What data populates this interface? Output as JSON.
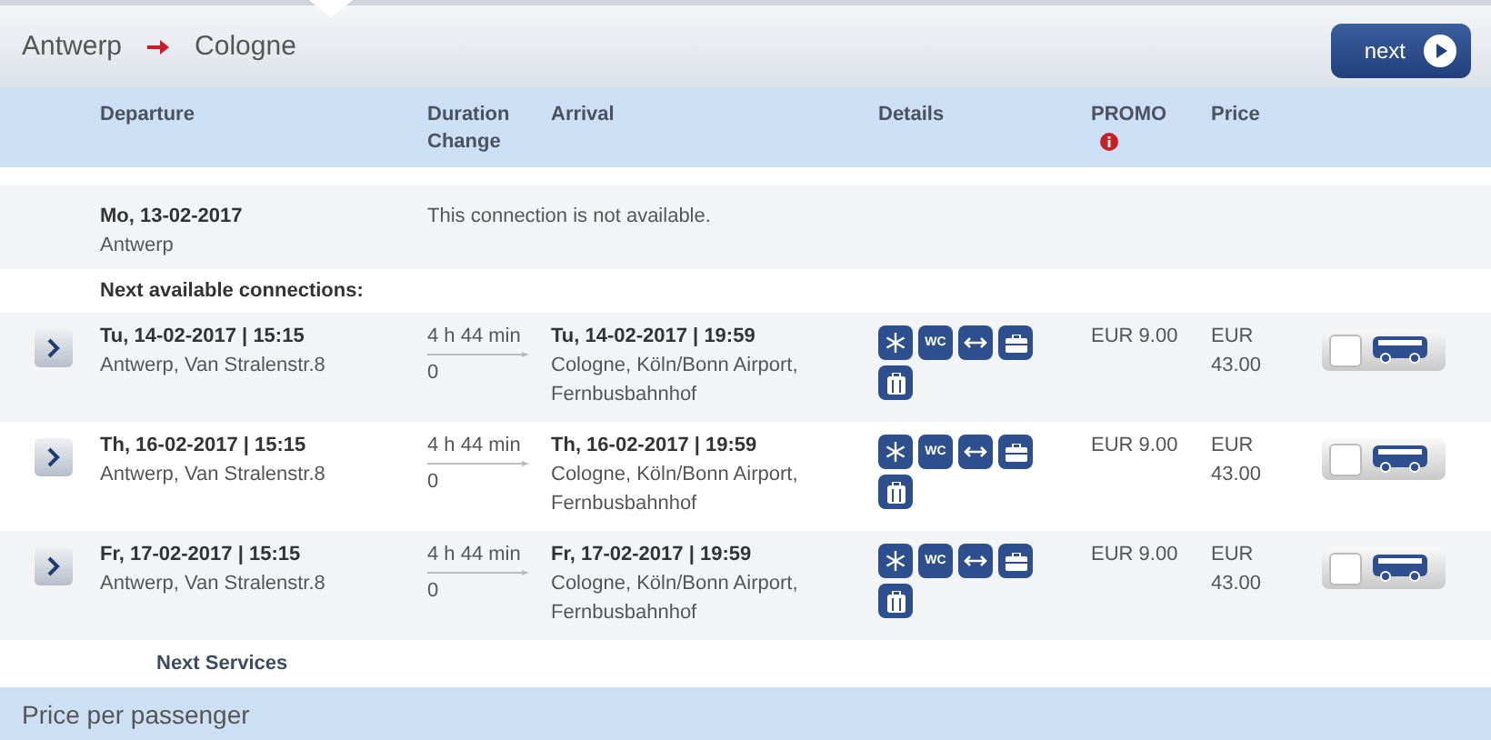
{
  "route": {
    "from": "Antwerp",
    "to": "Cologne"
  },
  "next_button": {
    "label": "next"
  },
  "columns": {
    "departure": "Departure",
    "duration": "Duration",
    "change": "Change",
    "arrival": "Arrival",
    "details": "Details",
    "promo": "PROMO",
    "price": "Price"
  },
  "unavailable": {
    "date": "Mo, 13-02-2017",
    "place": "Antwerp",
    "message": "This connection is not available."
  },
  "next_available_label": "Next available connections:",
  "connections": [
    {
      "departure": "Tu, 14-02-2017 | 15:15",
      "departure_place": "Antwerp, Van Stralenstr.8",
      "duration": "4 h 44 min",
      "changes": "0",
      "arrival": "Tu, 14-02-2017 | 19:59",
      "arrival_place": "Cologne, Köln/Bonn Airport, Fernbusbahnhof",
      "amenities": [
        {
          "kind": "snowflake"
        },
        {
          "kind": "text",
          "label": "WC"
        },
        {
          "kind": "arrows"
        },
        {
          "kind": "briefcase"
        },
        {
          "kind": "suitcase"
        }
      ],
      "promo": "EUR 9.00",
      "price_currency": "EUR",
      "price": "43.00",
      "selected": false
    },
    {
      "departure": "Th, 16-02-2017 | 15:15",
      "departure_place": "Antwerp, Van Stralenstr.8",
      "duration": "4 h 44 min",
      "changes": "0",
      "arrival": "Th, 16-02-2017 | 19:59",
      "arrival_place": "Cologne, Köln/Bonn Airport, Fernbusbahnhof",
      "amenities": [
        {
          "kind": "snowflake"
        },
        {
          "kind": "text",
          "label": "WC"
        },
        {
          "kind": "arrows"
        },
        {
          "kind": "briefcase"
        },
        {
          "kind": "suitcase"
        }
      ],
      "promo": "EUR 9.00",
      "price_currency": "EUR",
      "price": "43.00",
      "selected": false
    },
    {
      "departure": "Fr, 17-02-2017 | 15:15",
      "departure_place": "Antwerp, Van Stralenstr.8",
      "duration": "4 h 44 min",
      "changes": "0",
      "arrival": "Fr, 17-02-2017 | 19:59",
      "arrival_place": "Cologne, Köln/Bonn Airport, Fernbusbahnhof",
      "amenities": [
        {
          "kind": "snowflake"
        },
        {
          "kind": "text",
          "label": "WC"
        },
        {
          "kind": "arrows"
        },
        {
          "kind": "briefcase"
        },
        {
          "kind": "suitcase"
        }
      ],
      "promo": "EUR 9.00",
      "price_currency": "EUR",
      "price": "43.00",
      "selected": false
    }
  ],
  "next_services": "Next Services",
  "footer": "Price per passenger"
}
